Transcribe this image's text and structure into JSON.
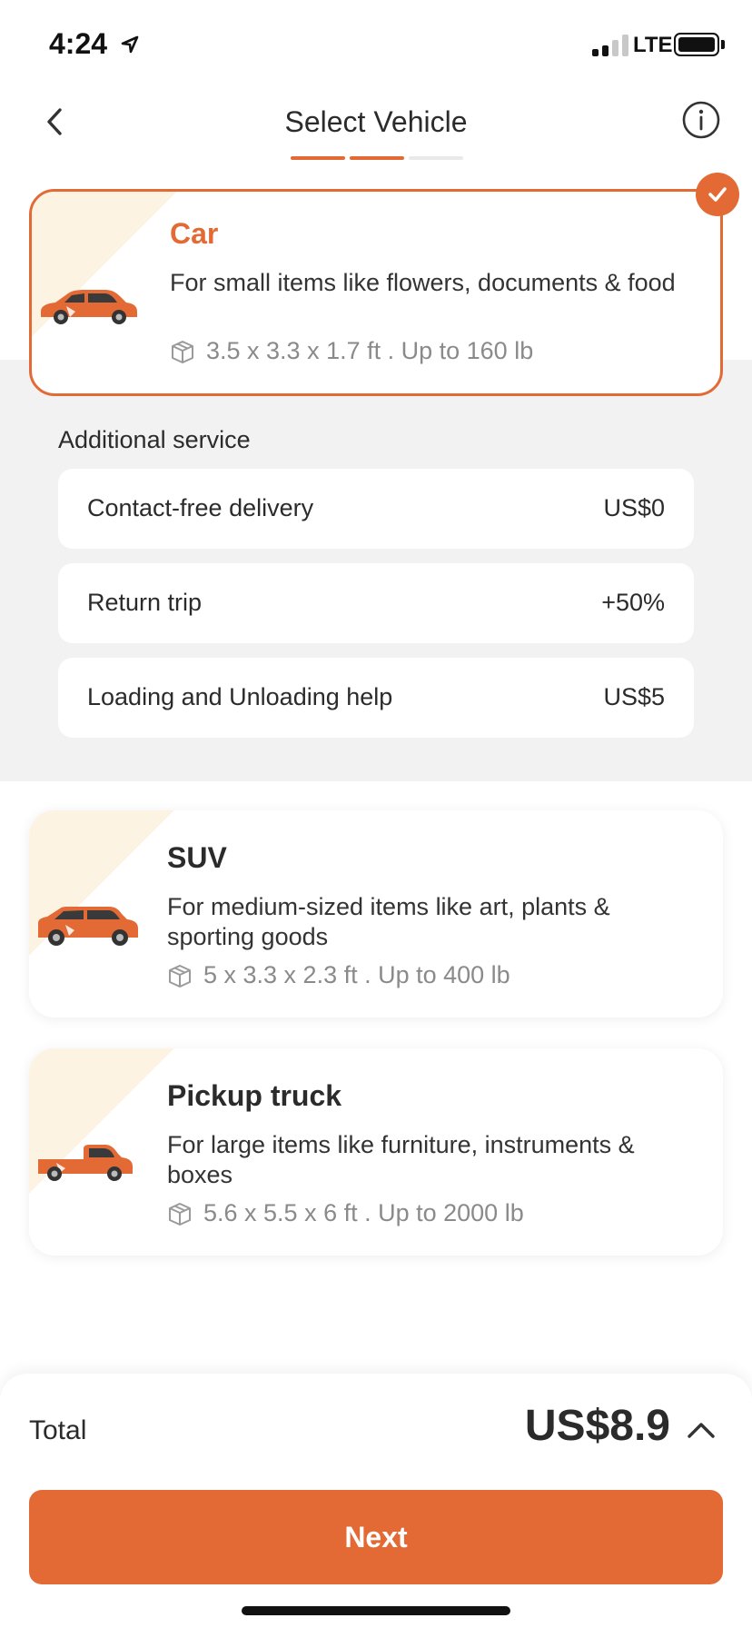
{
  "status_bar": {
    "time": "4:24",
    "network": "LTE",
    "icons": [
      "location-arrow-icon",
      "signal-icon",
      "battery-icon"
    ]
  },
  "header": {
    "title": "Select Vehicle",
    "back_icon": "chevron-left-icon",
    "info_icon": "info-icon",
    "progress": {
      "steps_total": 3,
      "steps_completed": 2
    }
  },
  "colors": {
    "accent": "#e46a35",
    "card_tint": "#fdf3e3",
    "panel_bg": "#f2f2f2"
  },
  "vehicles": [
    {
      "name": "Car",
      "description": "For small items like flowers, documents & food",
      "spec": "3.5 x 3.3 x 1.7 ft . Up to 160 lb",
      "selected": true,
      "icon": "car-icon"
    },
    {
      "name": "SUV",
      "description": "For medium-sized items like art, plants & sporting goods",
      "spec": "5 x 3.3 x 2.3 ft . Up to 400 lb",
      "selected": false,
      "icon": "suv-icon"
    },
    {
      "name": "Pickup truck",
      "description": "For large items like furniture, instruments & boxes",
      "spec": "5.6 x 5.5 x 6 ft . Up to 2000 lb",
      "selected": false,
      "icon": "pickup-truck-icon"
    }
  ],
  "additional_service": {
    "heading": "Additional service",
    "items": [
      {
        "label": "Contact-free delivery",
        "price": "US$0"
      },
      {
        "label": "Return trip",
        "price": "+50%"
      },
      {
        "label": "Loading and Unloading help",
        "price": "US$5"
      }
    ]
  },
  "footer": {
    "total_label": "Total",
    "total_value": "US$8.9",
    "expand_icon": "chevron-up-icon",
    "next_label": "Next"
  }
}
